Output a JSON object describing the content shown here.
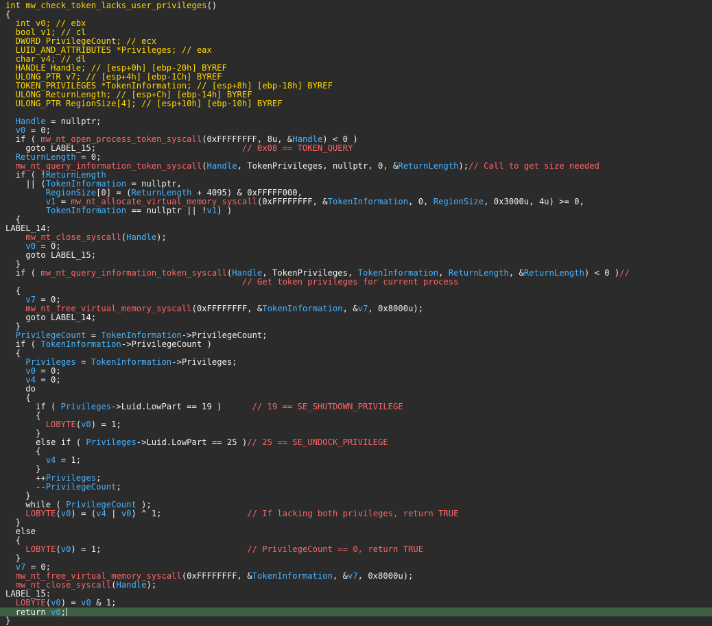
{
  "colors": {
    "background": "#2b2b2b",
    "text": "#f0f0f0",
    "variable": "#45b3ff",
    "function": "#ff6464",
    "comment": "#ff6464",
    "header": "#ffd700",
    "current_line": "#3f5f45"
  },
  "code": {
    "function_name": "int mw_check_token_lacks_user_privileges()",
    "lines": [
      [
        {
          "t": "int mw_check_token_lacks_user_privileges",
          "c": "header"
        },
        {
          "t": "()",
          "c": "plain"
        }
      ],
      [
        {
          "t": "{",
          "c": "plain"
        }
      ],
      [
        {
          "t": "  int v0; // ebx",
          "c": "header"
        }
      ],
      [
        {
          "t": "  bool v1; // cl",
          "c": "header"
        }
      ],
      [
        {
          "t": "  DWORD PrivilegeCount; // ecx",
          "c": "header"
        }
      ],
      [
        {
          "t": "  LUID_AND_ATTRIBUTES *Privileges; // eax",
          "c": "header"
        }
      ],
      [
        {
          "t": "  char v4; // dl",
          "c": "header"
        }
      ],
      [
        {
          "t": "  HANDLE Handle; // [esp+0h] [ebp-20h] BYREF",
          "c": "header"
        }
      ],
      [
        {
          "t": "  ULONG_PTR v7; // [esp+4h] [ebp-1Ch] BYREF",
          "c": "header"
        }
      ],
      [
        {
          "t": "  TOKEN_PRIVILEGES *TokenInformation; // [esp+8h] [ebp-18h] BYREF",
          "c": "header"
        }
      ],
      [
        {
          "t": "  ULONG ReturnLength; // [esp+Ch] [ebp-14h] BYREF",
          "c": "header"
        }
      ],
      [
        {
          "t": "  ULONG_PTR RegionSize[4]; // [esp+10h] [ebp-10h] BYREF",
          "c": "header"
        }
      ],
      [],
      [
        {
          "t": "  ",
          "c": "plain"
        },
        {
          "t": "Handle",
          "c": "variable"
        },
        {
          "t": " = nullptr;",
          "c": "plain"
        }
      ],
      [
        {
          "t": "  ",
          "c": "plain"
        },
        {
          "t": "v0",
          "c": "variable"
        },
        {
          "t": " = 0;",
          "c": "plain"
        }
      ],
      [
        {
          "t": "  if ( ",
          "c": "plain"
        },
        {
          "t": "mw_nt_open_process_token_syscall",
          "c": "function"
        },
        {
          "t": "(0xFFFFFFFF, 8u, &",
          "c": "plain"
        },
        {
          "t": "Handle",
          "c": "variable"
        },
        {
          "t": ") < 0 )",
          "c": "plain"
        }
      ],
      [
        {
          "t": "    goto LABEL_15;                             ",
          "c": "plain"
        },
        {
          "t": "// 0x08 == TOKEN_QUERY",
          "c": "comment"
        }
      ],
      [
        {
          "t": "  ",
          "c": "plain"
        },
        {
          "t": "ReturnLength",
          "c": "variable"
        },
        {
          "t": " = 0;",
          "c": "plain"
        }
      ],
      [
        {
          "t": "  ",
          "c": "plain"
        },
        {
          "t": "mw_nt_query_information_token_syscall",
          "c": "function"
        },
        {
          "t": "(",
          "c": "plain"
        },
        {
          "t": "Handle",
          "c": "variable"
        },
        {
          "t": ", TokenPrivileges, nullptr, 0, &",
          "c": "plain"
        },
        {
          "t": "ReturnLength",
          "c": "variable"
        },
        {
          "t": ");",
          "c": "plain"
        },
        {
          "t": "// Call to get size needed",
          "c": "comment"
        }
      ],
      [
        {
          "t": "  if ( !",
          "c": "plain"
        },
        {
          "t": "ReturnLength",
          "c": "variable"
        }
      ],
      [
        {
          "t": "    || (",
          "c": "plain"
        },
        {
          "t": "TokenInformation",
          "c": "variable"
        },
        {
          "t": " = nullptr,",
          "c": "plain"
        }
      ],
      [
        {
          "t": "        ",
          "c": "plain"
        },
        {
          "t": "RegionSize",
          "c": "variable"
        },
        {
          "t": "[0] = (",
          "c": "plain"
        },
        {
          "t": "ReturnLength",
          "c": "variable"
        },
        {
          "t": " + 4095) & 0xFFFFF000,",
          "c": "plain"
        }
      ],
      [
        {
          "t": "        ",
          "c": "plain"
        },
        {
          "t": "v1",
          "c": "variable"
        },
        {
          "t": " = ",
          "c": "plain"
        },
        {
          "t": "mw_nt_allocate_virtual_memory_syscall",
          "c": "function"
        },
        {
          "t": "(0xFFFFFFFF, &",
          "c": "plain"
        },
        {
          "t": "TokenInformation",
          "c": "variable"
        },
        {
          "t": ", 0, ",
          "c": "plain"
        },
        {
          "t": "RegionSize",
          "c": "variable"
        },
        {
          "t": ", 0x3000u, 4u) >= 0,",
          "c": "plain"
        }
      ],
      [
        {
          "t": "        ",
          "c": "plain"
        },
        {
          "t": "TokenInformation",
          "c": "variable"
        },
        {
          "t": " == nullptr || !",
          "c": "plain"
        },
        {
          "t": "v1",
          "c": "variable"
        },
        {
          "t": ") )",
          "c": "plain"
        }
      ],
      [
        {
          "t": "  {",
          "c": "plain"
        }
      ],
      [
        {
          "t": "LABEL_14:",
          "c": "plain"
        }
      ],
      [
        {
          "t": "    ",
          "c": "plain"
        },
        {
          "t": "mw_nt_close_syscall",
          "c": "function"
        },
        {
          "t": "(",
          "c": "plain"
        },
        {
          "t": "Handle",
          "c": "variable"
        },
        {
          "t": ");",
          "c": "plain"
        }
      ],
      [
        {
          "t": "    ",
          "c": "plain"
        },
        {
          "t": "v0",
          "c": "variable"
        },
        {
          "t": " = 0;",
          "c": "plain"
        }
      ],
      [
        {
          "t": "    goto LABEL_15;",
          "c": "plain"
        }
      ],
      [
        {
          "t": "  }",
          "c": "plain"
        }
      ],
      [
        {
          "t": "  if ( ",
          "c": "plain"
        },
        {
          "t": "mw_nt_query_information_token_syscall",
          "c": "function"
        },
        {
          "t": "(",
          "c": "plain"
        },
        {
          "t": "Handle",
          "c": "variable"
        },
        {
          "t": ", TokenPrivileges, ",
          "c": "plain"
        },
        {
          "t": "TokenInformation",
          "c": "variable"
        },
        {
          "t": ", ",
          "c": "plain"
        },
        {
          "t": "ReturnLength",
          "c": "variable"
        },
        {
          "t": ", &",
          "c": "plain"
        },
        {
          "t": "ReturnLength",
          "c": "variable"
        },
        {
          "t": ") < 0 )",
          "c": "plain"
        },
        {
          "t": "//",
          "c": "comment"
        }
      ],
      [
        {
          "t": "                                               ",
          "c": "plain"
        },
        {
          "t": "// Get token privileges for current process",
          "c": "comment"
        }
      ],
      [
        {
          "t": "  {",
          "c": "plain"
        }
      ],
      [
        {
          "t": "    ",
          "c": "plain"
        },
        {
          "t": "v7",
          "c": "variable"
        },
        {
          "t": " = 0;",
          "c": "plain"
        }
      ],
      [
        {
          "t": "    ",
          "c": "plain"
        },
        {
          "t": "mw_nt_free_virtual_memory_syscall",
          "c": "function"
        },
        {
          "t": "(0xFFFFFFFF, &",
          "c": "plain"
        },
        {
          "t": "TokenInformation",
          "c": "variable"
        },
        {
          "t": ", &",
          "c": "plain"
        },
        {
          "t": "v7",
          "c": "variable"
        },
        {
          "t": ", 0x8000u);",
          "c": "plain"
        }
      ],
      [
        {
          "t": "    goto LABEL_14;",
          "c": "plain"
        }
      ],
      [
        {
          "t": "  }",
          "c": "plain"
        }
      ],
      [
        {
          "t": "  ",
          "c": "plain"
        },
        {
          "t": "PrivilegeCount",
          "c": "variable"
        },
        {
          "t": " = ",
          "c": "plain"
        },
        {
          "t": "TokenInformation",
          "c": "variable"
        },
        {
          "t": "->PrivilegeCount;",
          "c": "plain"
        }
      ],
      [
        {
          "t": "  if ( ",
          "c": "plain"
        },
        {
          "t": "TokenInformation",
          "c": "variable"
        },
        {
          "t": "->PrivilegeCount )",
          "c": "plain"
        }
      ],
      [
        {
          "t": "  {",
          "c": "plain"
        }
      ],
      [
        {
          "t": "    ",
          "c": "plain"
        },
        {
          "t": "Privileges",
          "c": "variable"
        },
        {
          "t": " = ",
          "c": "plain"
        },
        {
          "t": "TokenInformation",
          "c": "variable"
        },
        {
          "t": "->Privileges;",
          "c": "plain"
        }
      ],
      [
        {
          "t": "    ",
          "c": "plain"
        },
        {
          "t": "v0",
          "c": "variable"
        },
        {
          "t": " = 0;",
          "c": "plain"
        }
      ],
      [
        {
          "t": "    ",
          "c": "plain"
        },
        {
          "t": "v4",
          "c": "variable"
        },
        {
          "t": " = 0;",
          "c": "plain"
        }
      ],
      [
        {
          "t": "    do",
          "c": "plain"
        }
      ],
      [
        {
          "t": "    {",
          "c": "plain"
        }
      ],
      [
        {
          "t": "      if ( ",
          "c": "plain"
        },
        {
          "t": "Privileges",
          "c": "variable"
        },
        {
          "t": "->Luid.LowPart == 19 )      ",
          "c": "plain"
        },
        {
          "t": "// 19 == SE_SHUTDOWN_PRIVILEGE",
          "c": "comment"
        }
      ],
      [
        {
          "t": "      {",
          "c": "plain"
        }
      ],
      [
        {
          "t": "        ",
          "c": "plain"
        },
        {
          "t": "LOBYTE",
          "c": "function"
        },
        {
          "t": "(",
          "c": "plain"
        },
        {
          "t": "v0",
          "c": "variable"
        },
        {
          "t": ") = 1;",
          "c": "plain"
        }
      ],
      [
        {
          "t": "      }",
          "c": "plain"
        }
      ],
      [
        {
          "t": "      else if ( ",
          "c": "plain"
        },
        {
          "t": "Privileges",
          "c": "variable"
        },
        {
          "t": "->Luid.LowPart == 25 )",
          "c": "plain"
        },
        {
          "t": "// 25 == SE_UNDOCK_PRIVILEGE",
          "c": "comment"
        }
      ],
      [
        {
          "t": "      {",
          "c": "plain"
        }
      ],
      [
        {
          "t": "        ",
          "c": "plain"
        },
        {
          "t": "v4",
          "c": "variable"
        },
        {
          "t": " = 1;",
          "c": "plain"
        }
      ],
      [
        {
          "t": "      }",
          "c": "plain"
        }
      ],
      [
        {
          "t": "      ++",
          "c": "plain"
        },
        {
          "t": "Privileges",
          "c": "variable"
        },
        {
          "t": ";",
          "c": "plain"
        }
      ],
      [
        {
          "t": "      --",
          "c": "plain"
        },
        {
          "t": "PrivilegeCount",
          "c": "variable"
        },
        {
          "t": ";",
          "c": "plain"
        }
      ],
      [
        {
          "t": "    }",
          "c": "plain"
        }
      ],
      [
        {
          "t": "    while ( ",
          "c": "plain"
        },
        {
          "t": "PrivilegeCount",
          "c": "variable"
        },
        {
          "t": " );",
          "c": "plain"
        }
      ],
      [
        {
          "t": "    ",
          "c": "plain"
        },
        {
          "t": "LOBYTE",
          "c": "function"
        },
        {
          "t": "(",
          "c": "plain"
        },
        {
          "t": "v0",
          "c": "variable"
        },
        {
          "t": ") = (",
          "c": "plain"
        },
        {
          "t": "v4",
          "c": "variable"
        },
        {
          "t": " | ",
          "c": "plain"
        },
        {
          "t": "v0",
          "c": "variable"
        },
        {
          "t": ") ^ 1;                 ",
          "c": "plain"
        },
        {
          "t": "// If lacking both privileges, return TRUE",
          "c": "comment"
        }
      ],
      [
        {
          "t": "  }",
          "c": "plain"
        }
      ],
      [
        {
          "t": "  else",
          "c": "plain"
        }
      ],
      [
        {
          "t": "  {",
          "c": "plain"
        }
      ],
      [
        {
          "t": "    ",
          "c": "plain"
        },
        {
          "t": "LOBYTE",
          "c": "function"
        },
        {
          "t": "(",
          "c": "plain"
        },
        {
          "t": "v0",
          "c": "variable"
        },
        {
          "t": ") = 1;                             ",
          "c": "plain"
        },
        {
          "t": "// PrivilegeCount == 0, return TRUE",
          "c": "comment"
        }
      ],
      [
        {
          "t": "  }",
          "c": "plain"
        }
      ],
      [
        {
          "t": "  ",
          "c": "plain"
        },
        {
          "t": "v7",
          "c": "variable"
        },
        {
          "t": " = 0;",
          "c": "plain"
        }
      ],
      [
        {
          "t": "  ",
          "c": "plain"
        },
        {
          "t": "mw_nt_free_virtual_memory_syscall",
          "c": "function"
        },
        {
          "t": "(0xFFFFFFFF, &",
          "c": "plain"
        },
        {
          "t": "TokenInformation",
          "c": "variable"
        },
        {
          "t": ", &",
          "c": "plain"
        },
        {
          "t": "v7",
          "c": "variable"
        },
        {
          "t": ", 0x8000u);",
          "c": "plain"
        }
      ],
      [
        {
          "t": "  ",
          "c": "plain"
        },
        {
          "t": "mw_nt_close_syscall",
          "c": "function"
        },
        {
          "t": "(",
          "c": "plain"
        },
        {
          "t": "Handle",
          "c": "variable"
        },
        {
          "t": ");",
          "c": "plain"
        }
      ],
      [
        {
          "t": "LABEL_15:",
          "c": "plain"
        }
      ],
      [
        {
          "t": "  ",
          "c": "plain"
        },
        {
          "t": "LOBYTE",
          "c": "function"
        },
        {
          "t": "(",
          "c": "plain"
        },
        {
          "t": "v0",
          "c": "variable"
        },
        {
          "t": ") = ",
          "c": "plain"
        },
        {
          "t": "v0",
          "c": "variable"
        },
        {
          "t": " & 1;",
          "c": "plain"
        }
      ],
      [
        {
          "t": "  return ",
          "c": "plain"
        },
        {
          "t": "v0",
          "c": "variable"
        },
        {
          "t": ";",
          "c": "plain"
        }
      ],
      [
        {
          "t": "}",
          "c": "plain"
        }
      ]
    ],
    "current_line_index": 68
  }
}
